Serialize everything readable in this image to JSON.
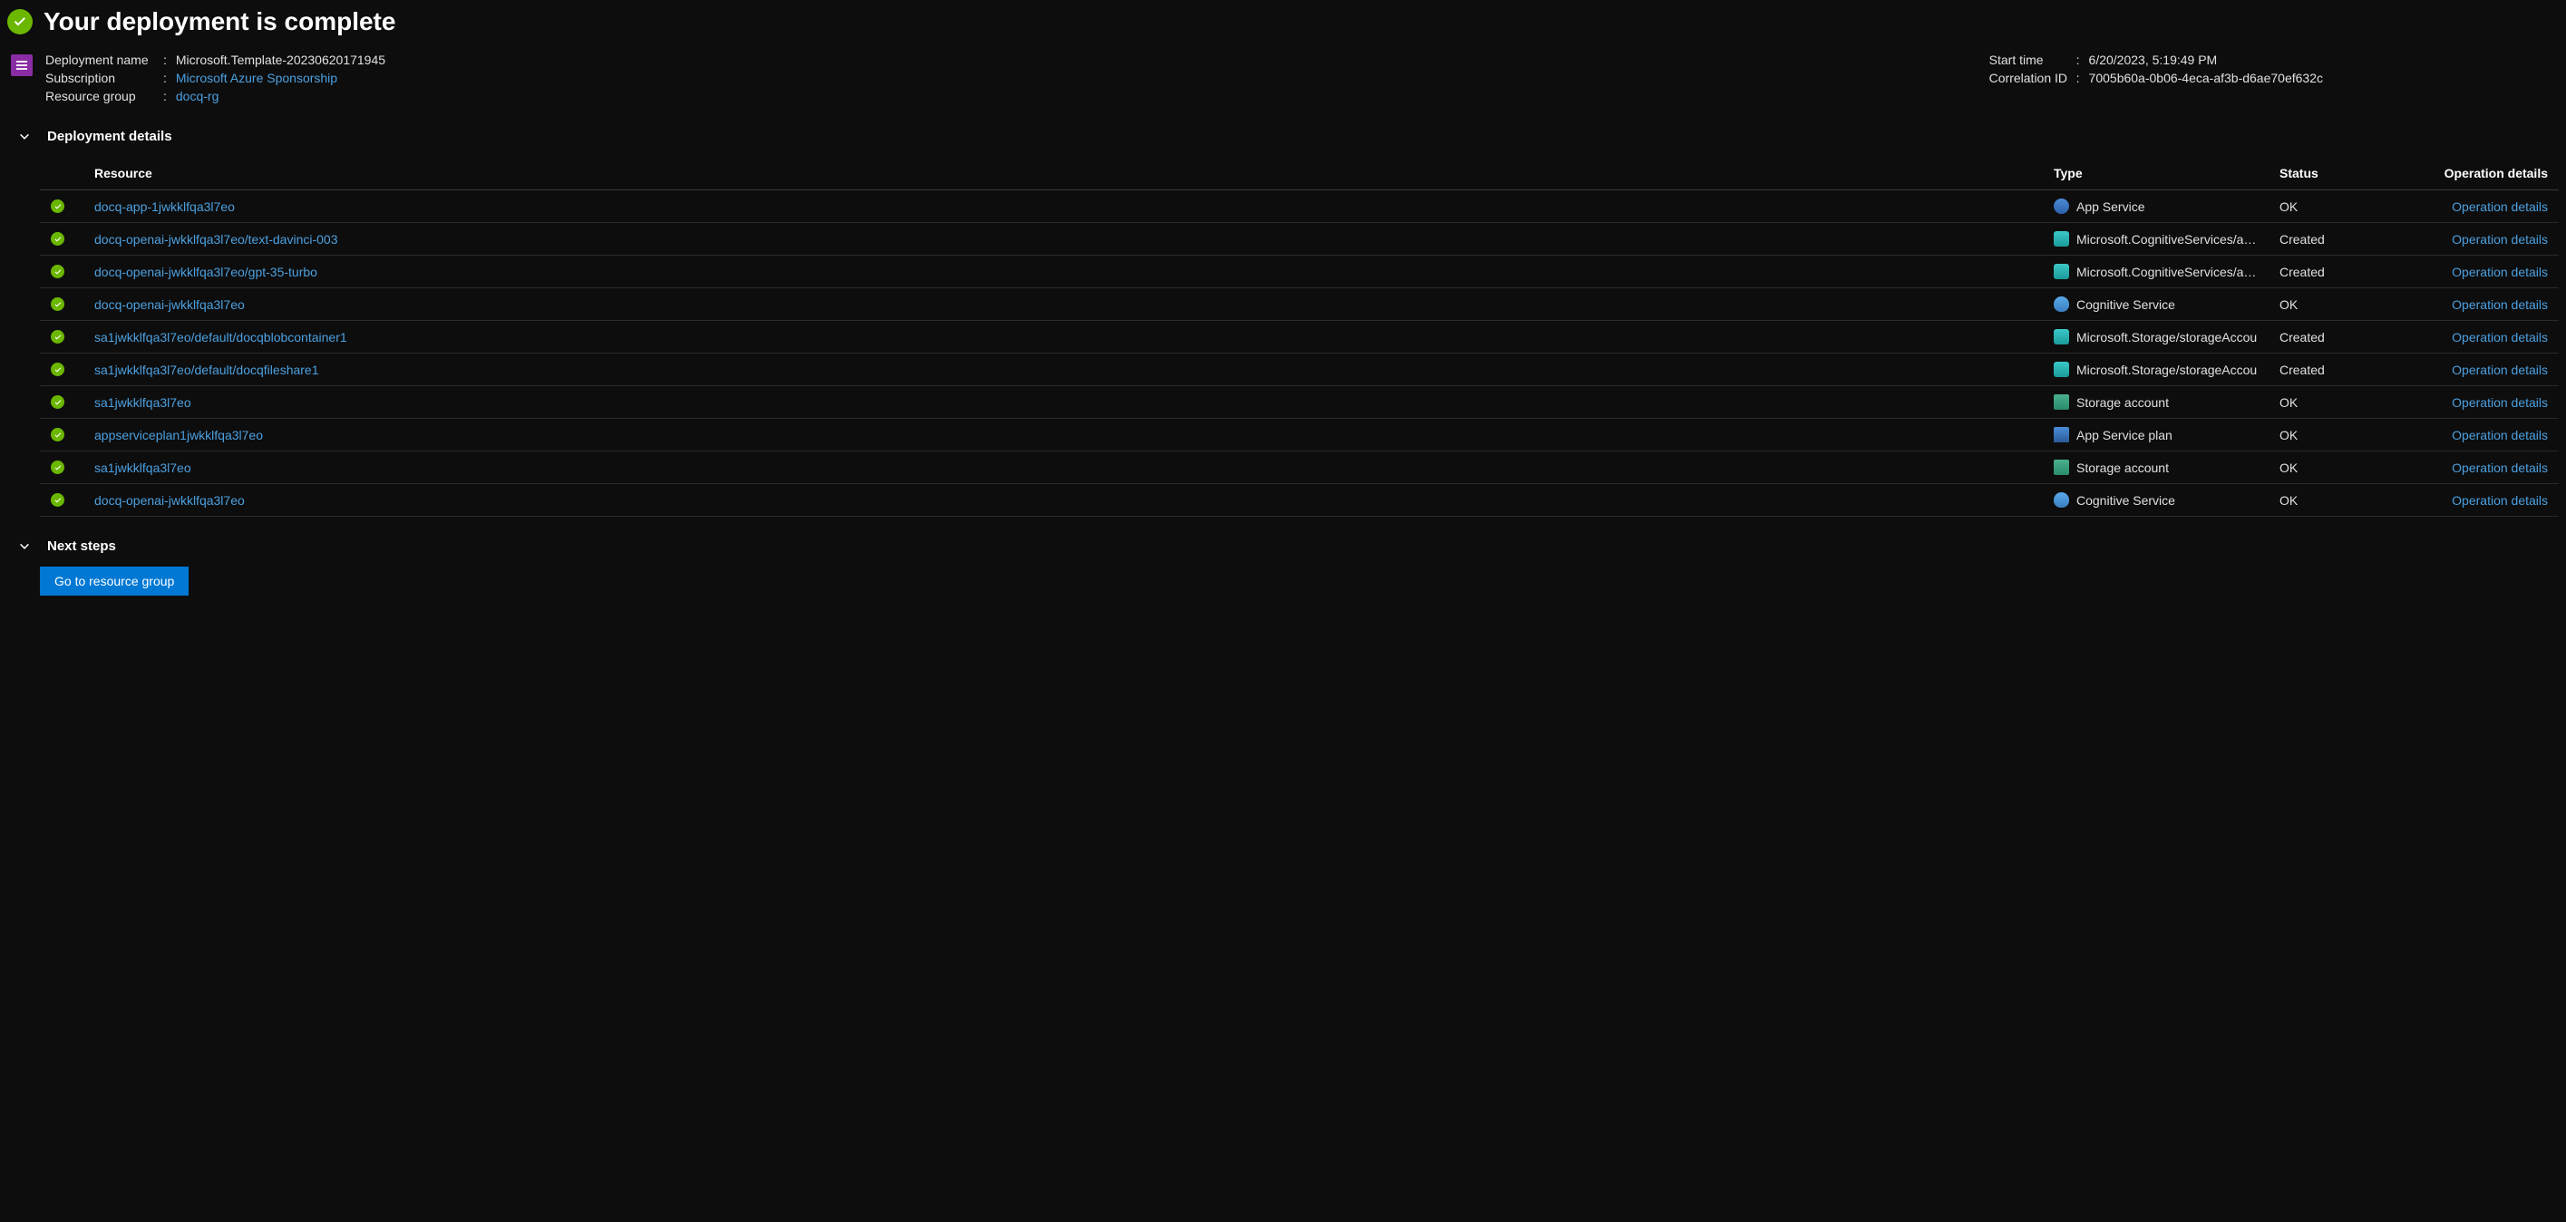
{
  "header": {
    "title": "Your deployment is complete"
  },
  "summary": {
    "left": {
      "deployment_name_label": "Deployment name",
      "deployment_name_value": "Microsoft.Template-20230620171945",
      "subscription_label": "Subscription",
      "subscription_value": "Microsoft Azure Sponsorship",
      "resource_group_label": "Resource group",
      "resource_group_value": "docq-rg"
    },
    "right": {
      "start_time_label": "Start time",
      "start_time_value": "6/20/2023, 5:19:49 PM",
      "correlation_id_label": "Correlation ID",
      "correlation_id_value": "7005b60a-0b06-4eca-af3b-d6ae70ef632c"
    }
  },
  "sections": {
    "deployment_details": "Deployment details",
    "next_steps": "Next steps"
  },
  "table": {
    "headers": {
      "resource": "Resource",
      "type": "Type",
      "status": "Status",
      "operation_details": "Operation details"
    },
    "operation_details_link": "Operation details",
    "rows": [
      {
        "resource": "docq-app-1jwkklfqa3l7eo",
        "type": "App Service",
        "status": "OK",
        "icon": "appservice"
      },
      {
        "resource": "docq-openai-jwkklfqa3l7eo/text-davinci-003",
        "type": "Microsoft.CognitiveServices/acco",
        "status": "Created",
        "icon": "arm"
      },
      {
        "resource": "docq-openai-jwkklfqa3l7eo/gpt-35-turbo",
        "type": "Microsoft.CognitiveServices/acco",
        "status": "Created",
        "icon": "arm"
      },
      {
        "resource": "docq-openai-jwkklfqa3l7eo",
        "type": "Cognitive Service",
        "status": "OK",
        "icon": "cognitive"
      },
      {
        "resource": "sa1jwkklfqa3l7eo/default/docqblobcontainer1",
        "type": "Microsoft.Storage/storageAccou",
        "status": "Created",
        "icon": "arm"
      },
      {
        "resource": "sa1jwkklfqa3l7eo/default/docqfileshare1",
        "type": "Microsoft.Storage/storageAccou",
        "status": "Created",
        "icon": "arm"
      },
      {
        "resource": "sa1jwkklfqa3l7eo",
        "type": "Storage account",
        "status": "OK",
        "icon": "storage"
      },
      {
        "resource": "appserviceplan1jwkklfqa3l7eo",
        "type": "App Service plan",
        "status": "OK",
        "icon": "asp"
      },
      {
        "resource": "sa1jwkklfqa3l7eo",
        "type": "Storage account",
        "status": "OK",
        "icon": "storage"
      },
      {
        "resource": "docq-openai-jwkklfqa3l7eo",
        "type": "Cognitive Service",
        "status": "OK",
        "icon": "cognitive"
      }
    ]
  },
  "buttons": {
    "go_to_resource_group": "Go to resource group"
  }
}
